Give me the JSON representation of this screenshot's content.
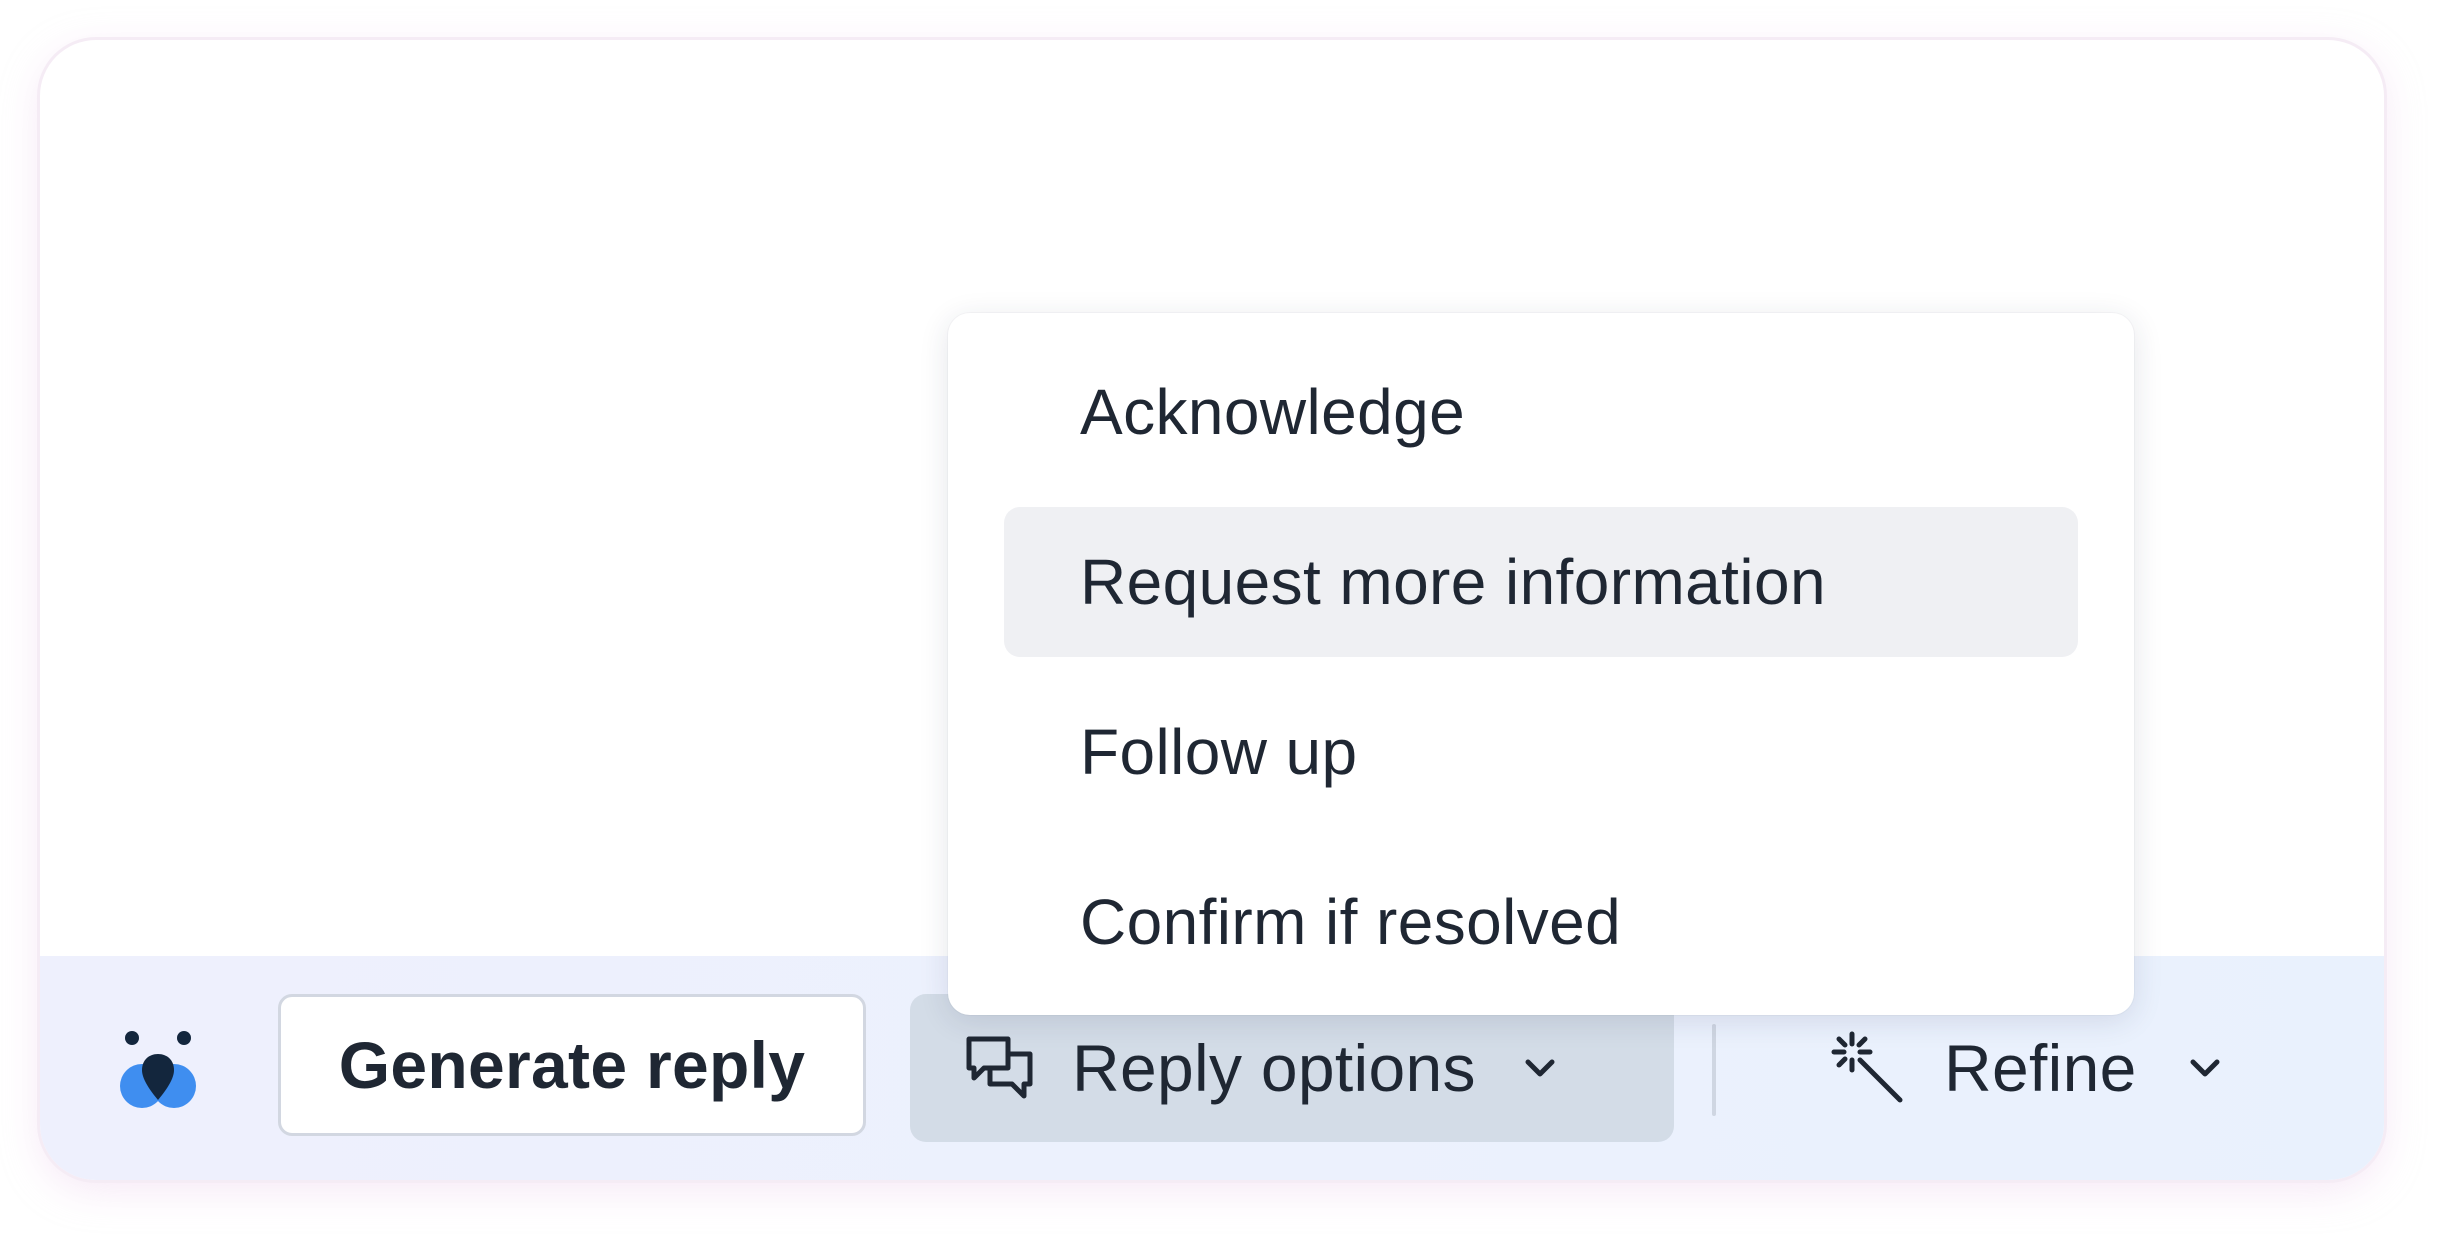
{
  "toolbar": {
    "generate_label": "Generate reply",
    "reply_options_label": "Reply options",
    "refine_label": "Refine"
  },
  "menu": {
    "items": [
      {
        "label": "Acknowledge",
        "active": false
      },
      {
        "label": "Request more information",
        "active": true
      },
      {
        "label": "Follow up",
        "active": false
      },
      {
        "label": "Confirm if resolved",
        "active": false
      }
    ]
  },
  "icons": {
    "logo": "assistant-logo-icon",
    "reply_options": "chat-bubbles-icon",
    "refine": "magic-wand-icon",
    "chevron": "chevron-down-icon"
  },
  "colors": {
    "text": "#1f2733",
    "reply_options_bg": "#d3dce7",
    "menu_active_bg": "#eff0f3",
    "logo_blue": "#3f8ef0",
    "logo_dark": "#13263d"
  }
}
